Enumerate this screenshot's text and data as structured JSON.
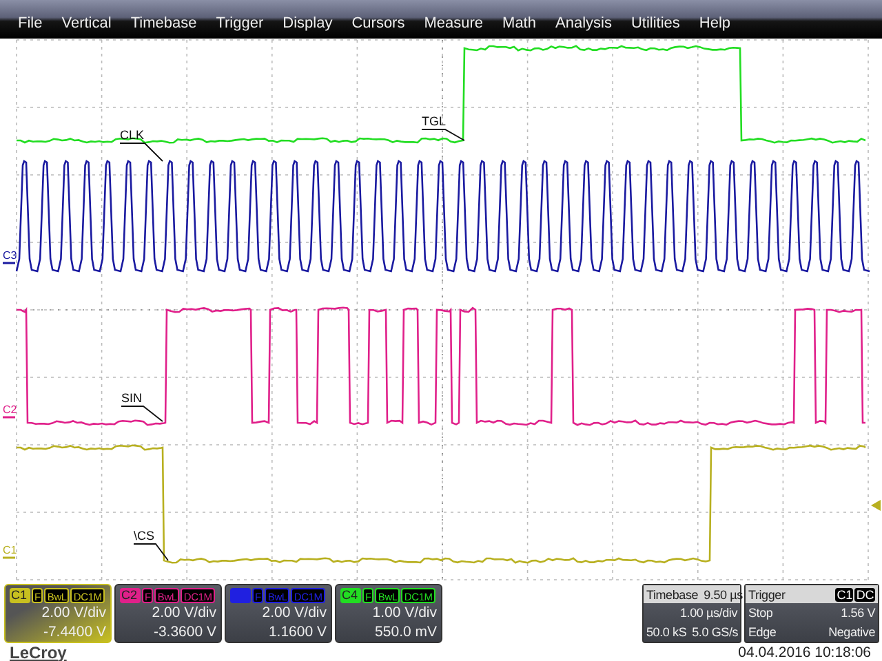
{
  "menu": [
    "File",
    "Vertical",
    "Timebase",
    "Trigger",
    "Display",
    "Cursors",
    "Measure",
    "Math",
    "Analysis",
    "Utilities",
    "Help"
  ],
  "traces": [
    {
      "kind": "toggle",
      "color": "#22dd22"
    },
    {
      "kind": "clock",
      "color": "#1a1aa0",
      "marker": "C3"
    },
    {
      "kind": "data",
      "color": "#e0208a",
      "marker": "C2"
    },
    {
      "kind": "select",
      "color": "#b8b020",
      "marker": "C1"
    }
  ],
  "labels": [
    {
      "text": "CLK"
    },
    {
      "text": "TGL"
    },
    {
      "text": "SIN"
    },
    {
      "text": "\\CS"
    }
  ],
  "channels": [
    {
      "badge": "C1",
      "color": "#c8c020",
      "selected": true,
      "flags": [
        "F",
        "BwL",
        "DC1M"
      ],
      "scale": "2.00 V/div",
      "offset": "-7.4400 V"
    },
    {
      "badge": "C2",
      "color": "#e0208a",
      "selected": false,
      "flags": [
        "F",
        "BwL",
        "DC1M"
      ],
      "scale": "2.00 V/div",
      "offset": "-3.3600 V"
    },
    {
      "color": "#2020e0",
      "selected": false,
      "flags": [
        "F",
        "BwL",
        "DC1M"
      ],
      "scale": "2.00 V/div",
      "offset": "1.1600 V"
    },
    {
      "badge": "C4",
      "color": "#22dd22",
      "selected": false,
      "flags": [
        "F",
        "BwL",
        "DC1M"
      ],
      "scale": "1.00 V/div",
      "offset": "550.0 mV"
    }
  ],
  "timebase": {
    "title": "Timebase",
    "delay": "9.50 µs",
    "scale": "1.00 µs/div",
    "samples": "50.0 kS",
    "rate": "5.0 GS/s"
  },
  "trigger": {
    "title": "Trigger",
    "source": "C1",
    "coupling": "DC",
    "mode": "Stop",
    "level": "1.56 V",
    "type": "Edge",
    "slope": "Negative"
  },
  "brand": "LeCroy",
  "datetime": "04.04.2016 10:18:06"
}
